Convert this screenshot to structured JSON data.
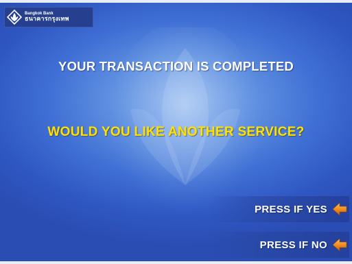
{
  "bank": {
    "name_en": "Bangkok Bank",
    "name_th": "ธนาคารกรุงเทพ",
    "logo_icon": "lotus-diamond-icon"
  },
  "messages": {
    "completed": "YOUR TRANSACTION IS COMPLETED",
    "question": "WOULD YOU LIKE ANOTHER SERVICE?"
  },
  "options": {
    "yes_label": "PRESS IF YES",
    "no_label": "PRESS IF NO",
    "arrow_icon": "arrow-left-icon"
  },
  "colors": {
    "background": "#3f6fd4",
    "question_text": "#ffe100",
    "arrow": "#f08a18"
  }
}
